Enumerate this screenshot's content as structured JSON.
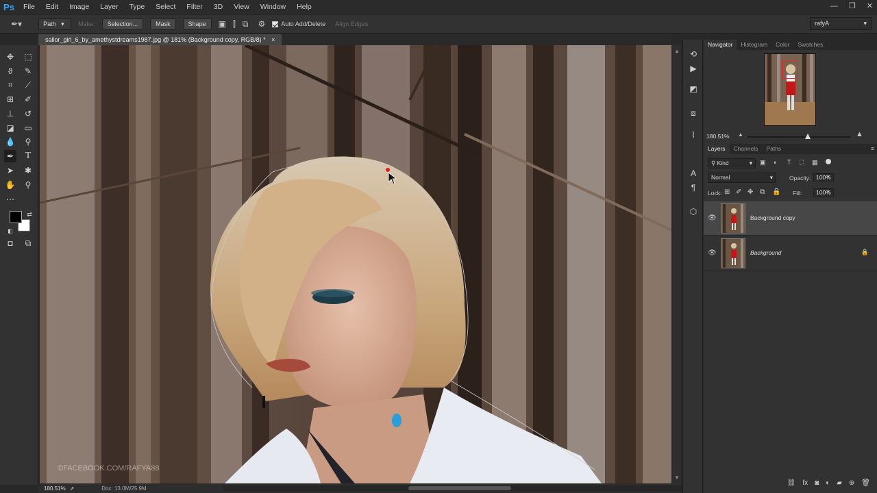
{
  "app": {
    "logo": "Ps"
  },
  "menu": [
    "File",
    "Edit",
    "Image",
    "Layer",
    "Type",
    "Select",
    "Filter",
    "3D",
    "View",
    "Window",
    "Help"
  ],
  "window_controls": [
    "—",
    "❐",
    "✕"
  ],
  "options_bar": {
    "tool_mode": "Path",
    "make_label": "Make:",
    "selection_btn": "Selection...",
    "mask_btn": "Mask",
    "shape_btn": "Shape",
    "auto_add_delete": "Auto Add/Delete",
    "align_edges": "Align Edges",
    "workspace": "rafyA"
  },
  "document_tab": {
    "title": "sailor_girl_6_by_amethystdreams1987.jpg @ 181% (Background copy, RGB/8) *",
    "close": "×"
  },
  "canvas": {
    "watermark": "©FACEBOOK.COM/RAFYA88"
  },
  "status_bar": {
    "zoom": "180.51%",
    "doc": "Doc: 13.0M/25.9M"
  },
  "navigator": {
    "tabs": [
      "Navigator",
      "Histogram",
      "Color",
      "Swatches"
    ],
    "zoom": "180.51%"
  },
  "layers_panel": {
    "tabs": [
      "Layers",
      "Channels",
      "Paths"
    ],
    "filter_kind": "Kind",
    "blend_mode": "Normal",
    "opacity_label": "Opacity:",
    "opacity_value": "100%",
    "lock_label": "Lock:",
    "fill_label": "Fill:",
    "fill_value": "100%",
    "layers": [
      {
        "name": "Background copy",
        "selected": true,
        "locked": false
      },
      {
        "name": "Background",
        "selected": false,
        "locked": true
      }
    ]
  },
  "colors": {
    "accent": "#31a8ff",
    "path_anchor": "#e02020",
    "selected_layer": "#474747"
  }
}
